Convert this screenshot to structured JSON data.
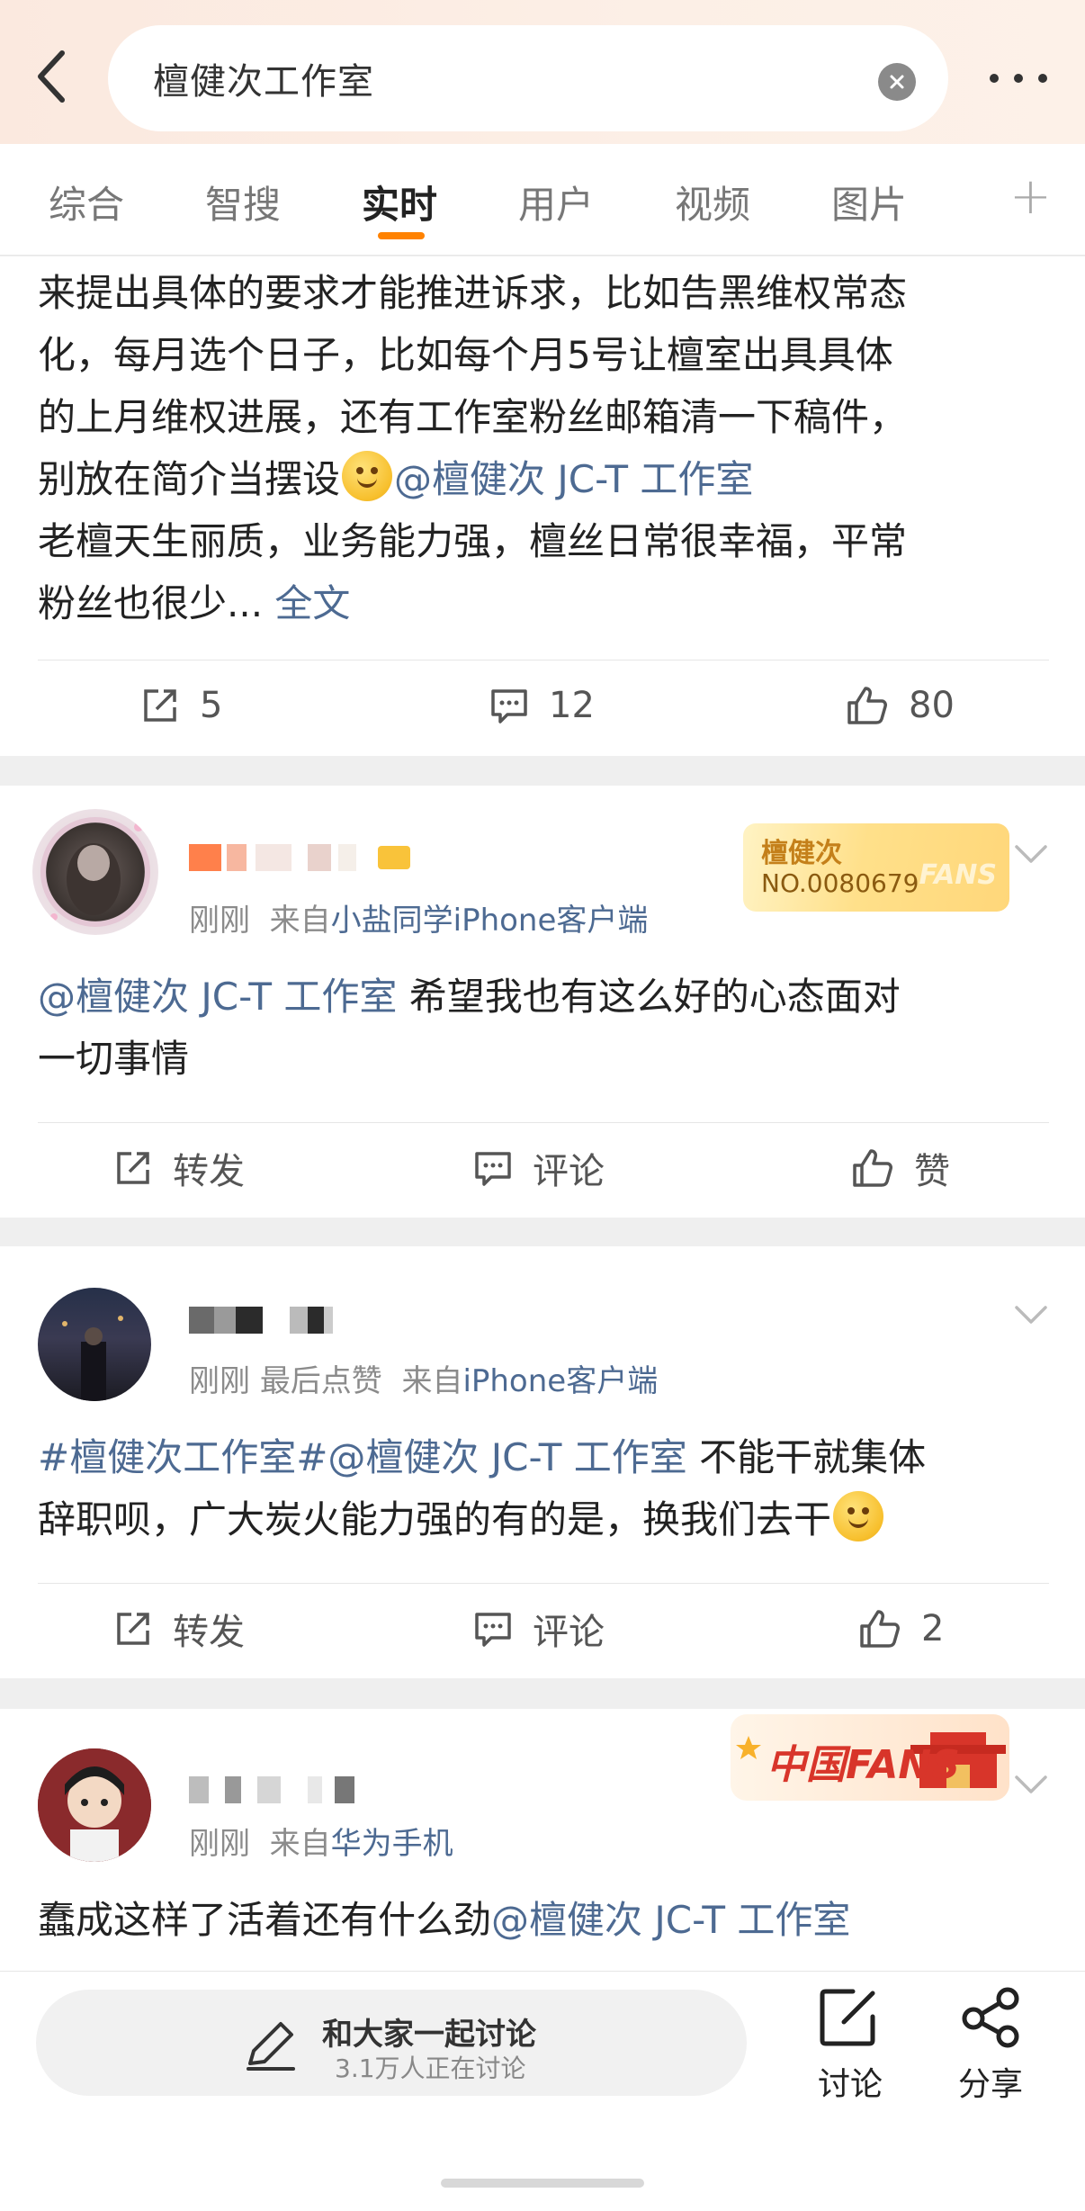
{
  "header": {
    "search_value": "檀健次工作室",
    "icons": {
      "back": "chevron-left-icon",
      "clear": "clear-icon",
      "more": "more-dots-icon"
    }
  },
  "tabs": [
    {
      "label": "综合",
      "active": false
    },
    {
      "label": "智搜",
      "active": false
    },
    {
      "label": "实时",
      "active": true
    },
    {
      "label": "用户",
      "active": false
    },
    {
      "label": "视频",
      "active": false
    },
    {
      "label": "图片",
      "active": false
    }
  ],
  "tab_plus": "+",
  "posts": [
    {
      "text_lines": {
        "l1": "来提出具体的要求才能推进诉求，比如告黑维权常态",
        "l2": "化，每月选个日子，比如每个月5号让檀室出具具体",
        "l3": "的上月维权进展，还有工作室粉丝邮箱清一下稿件，",
        "l4a": "别放在简介当摆设",
        "l4mention": "@檀健次 JC-T 工作室",
        "l5": "老檀天生丽质，业务能力强，檀丝日常很幸福，平常",
        "l6": "粉丝也很少...",
        "more_link": "全文"
      },
      "actions": {
        "repost": "5",
        "comment": "12",
        "like": "80"
      }
    },
    {
      "badge": {
        "line1": "檀健次",
        "line2": "NO.0080679",
        "deco": "FANS"
      },
      "meta": {
        "time": "刚刚",
        "from_prefix": "来自",
        "source": "小盐同学iPhone客户端"
      },
      "mention": "@檀健次 JC-T 工作室",
      "text_a": " 希望我也有这么好的心态面对",
      "text_b": "一切事情",
      "actions": {
        "repost": "转发",
        "comment": "评论",
        "like": "赞"
      }
    },
    {
      "meta": {
        "time": "刚刚",
        "extra": "最后点赞",
        "from_prefix": "来自",
        "source": "iPhone客户端"
      },
      "topic": "#檀健次工作室#",
      "mention": "@檀健次 JC-T 工作室",
      "text_a": " 不能干就集体",
      "text_b": "辞职呗，广大炭火能力强的有的是，换我们去干",
      "actions": {
        "repost": "转发",
        "comment": "评论",
        "like": "2"
      }
    },
    {
      "badge": {
        "text": "中国FANS"
      },
      "meta": {
        "time": "刚刚",
        "from_prefix": "来自",
        "source": "华为手机"
      },
      "text_a": "蠢成这样了活着还有什么劲",
      "mention": "@檀健次 JC-T 工作室"
    }
  ],
  "bottom_bar": {
    "discuss_title": "和大家一起讨论",
    "discuss_sub": "3.1万人正在讨论",
    "btn_discuss": "讨论",
    "btn_share": "分享"
  },
  "colors": {
    "accent": "#ff8200",
    "link": "#4d6a92",
    "text": "#222222",
    "muted": "#8b8b8b"
  }
}
